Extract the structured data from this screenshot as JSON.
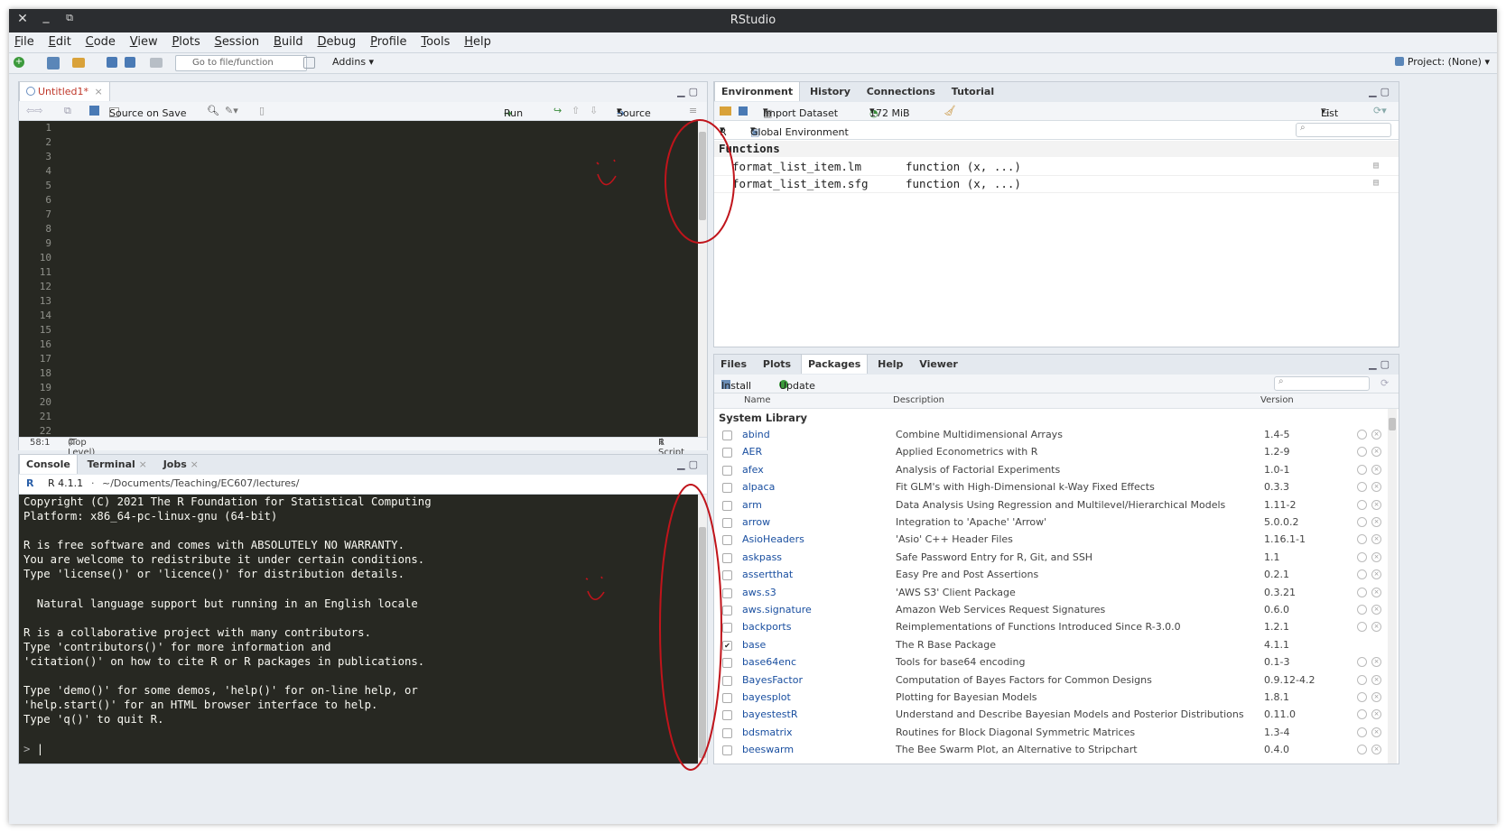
{
  "window": {
    "title": "RStudio"
  },
  "menu": [
    "File",
    "Edit",
    "Code",
    "View",
    "Plots",
    "Session",
    "Build",
    "Debug",
    "Profile",
    "Tools",
    "Help"
  ],
  "toolbar": {
    "goto_placeholder": "Go to file/function",
    "addins": "Addins",
    "project": "Project: (None)"
  },
  "source": {
    "tab": "Untitled1*",
    "source_on_save": "Source on Save",
    "run": "Run",
    "source_btn": "Source",
    "line_numbers": [
      "1",
      "2",
      "3",
      "4",
      "5",
      "6",
      "7",
      "8",
      "9",
      "10",
      "11",
      "12",
      "13",
      "14",
      "15",
      "16",
      "17",
      "18",
      "19",
      "20",
      "21",
      "22"
    ],
    "status_pos": "58:1",
    "status_scope": "(Top Level)",
    "status_type": "R Script"
  },
  "console": {
    "tabs": [
      "Console",
      "Terminal",
      "Jobs"
    ],
    "version": "R 4.1.1",
    "path": "~/Documents/Teaching/EC607/lectures/",
    "lines": [
      "Copyright (C) 2021 The R Foundation for Statistical Computing",
      "Platform: x86_64-pc-linux-gnu (64-bit)",
      "",
      "R is free software and comes with ABSOLUTELY NO WARRANTY.",
      "You are welcome to redistribute it under certain conditions.",
      "Type 'license()' or 'licence()' for distribution details.",
      "",
      "  Natural language support but running in an English locale",
      "",
      "R is a collaborative project with many contributors.",
      "Type 'contributors()' for more information and",
      "'citation()' on how to cite R or R packages in publications.",
      "",
      "Type 'demo()' for some demos, 'help()' for on-line help, or",
      "'help.start()' for an HTML browser interface to help.",
      "Type 'q()' to quit R."
    ],
    "prompt": ">"
  },
  "environment": {
    "tabs": [
      "Environment",
      "History",
      "Connections",
      "Tutorial"
    ],
    "import": "Import Dataset",
    "memory": "172 MiB",
    "view": "List",
    "lang": "R",
    "scope": "Global Environment",
    "section": "Functions",
    "rows": [
      {
        "name": "format_list_item.lm",
        "value": "function (x, ...)"
      },
      {
        "name": "format_list_item.sfg",
        "value": "function (x, ...)"
      }
    ]
  },
  "packages": {
    "tabs": [
      "Files",
      "Plots",
      "Packages",
      "Help",
      "Viewer"
    ],
    "install": "Install",
    "update": "Update",
    "headers": {
      "name": "Name",
      "description": "Description",
      "version": "Version"
    },
    "section": "System Library",
    "rows": [
      {
        "name": "abind",
        "desc": "Combine Multidimensional Arrays",
        "ver": "1.4-5",
        "checked": false
      },
      {
        "name": "AER",
        "desc": "Applied Econometrics with R",
        "ver": "1.2-9",
        "checked": false
      },
      {
        "name": "afex",
        "desc": "Analysis of Factorial Experiments",
        "ver": "1.0-1",
        "checked": false
      },
      {
        "name": "alpaca",
        "desc": "Fit GLM's with High-Dimensional k-Way Fixed Effects",
        "ver": "0.3.3",
        "checked": false
      },
      {
        "name": "arm",
        "desc": "Data Analysis Using Regression and Multilevel/Hierarchical Models",
        "ver": "1.11-2",
        "checked": false
      },
      {
        "name": "arrow",
        "desc": "Integration to 'Apache' 'Arrow'",
        "ver": "5.0.0.2",
        "checked": false
      },
      {
        "name": "AsioHeaders",
        "desc": "'Asio' C++ Header Files",
        "ver": "1.16.1-1",
        "checked": false
      },
      {
        "name": "askpass",
        "desc": "Safe Password Entry for R, Git, and SSH",
        "ver": "1.1",
        "checked": false
      },
      {
        "name": "assertthat",
        "desc": "Easy Pre and Post Assertions",
        "ver": "0.2.1",
        "checked": false
      },
      {
        "name": "aws.s3",
        "desc": "'AWS S3' Client Package",
        "ver": "0.3.21",
        "checked": false
      },
      {
        "name": "aws.signature",
        "desc": "Amazon Web Services Request Signatures",
        "ver": "0.6.0",
        "checked": false
      },
      {
        "name": "backports",
        "desc": "Reimplementations of Functions Introduced Since R-3.0.0",
        "ver": "1.2.1",
        "checked": false
      },
      {
        "name": "base",
        "desc": "The R Base Package",
        "ver": "4.1.1",
        "checked": true
      },
      {
        "name": "base64enc",
        "desc": "Tools for base64 encoding",
        "ver": "0.1-3",
        "checked": false
      },
      {
        "name": "BayesFactor",
        "desc": "Computation of Bayes Factors for Common Designs",
        "ver": "0.9.12-4.2",
        "checked": false
      },
      {
        "name": "bayesplot",
        "desc": "Plotting for Bayesian Models",
        "ver": "1.8.1",
        "checked": false
      },
      {
        "name": "bayestestR",
        "desc": "Understand and Describe Bayesian Models and Posterior Distributions",
        "ver": "0.11.0",
        "checked": false
      },
      {
        "name": "bdsmatrix",
        "desc": "Routines for Block Diagonal Symmetric Matrices",
        "ver": "1.3-4",
        "checked": false
      },
      {
        "name": "beeswarm",
        "desc": "The Bee Swarm Plot, an Alternative to Stripchart",
        "ver": "0.4.0",
        "checked": false
      }
    ]
  }
}
